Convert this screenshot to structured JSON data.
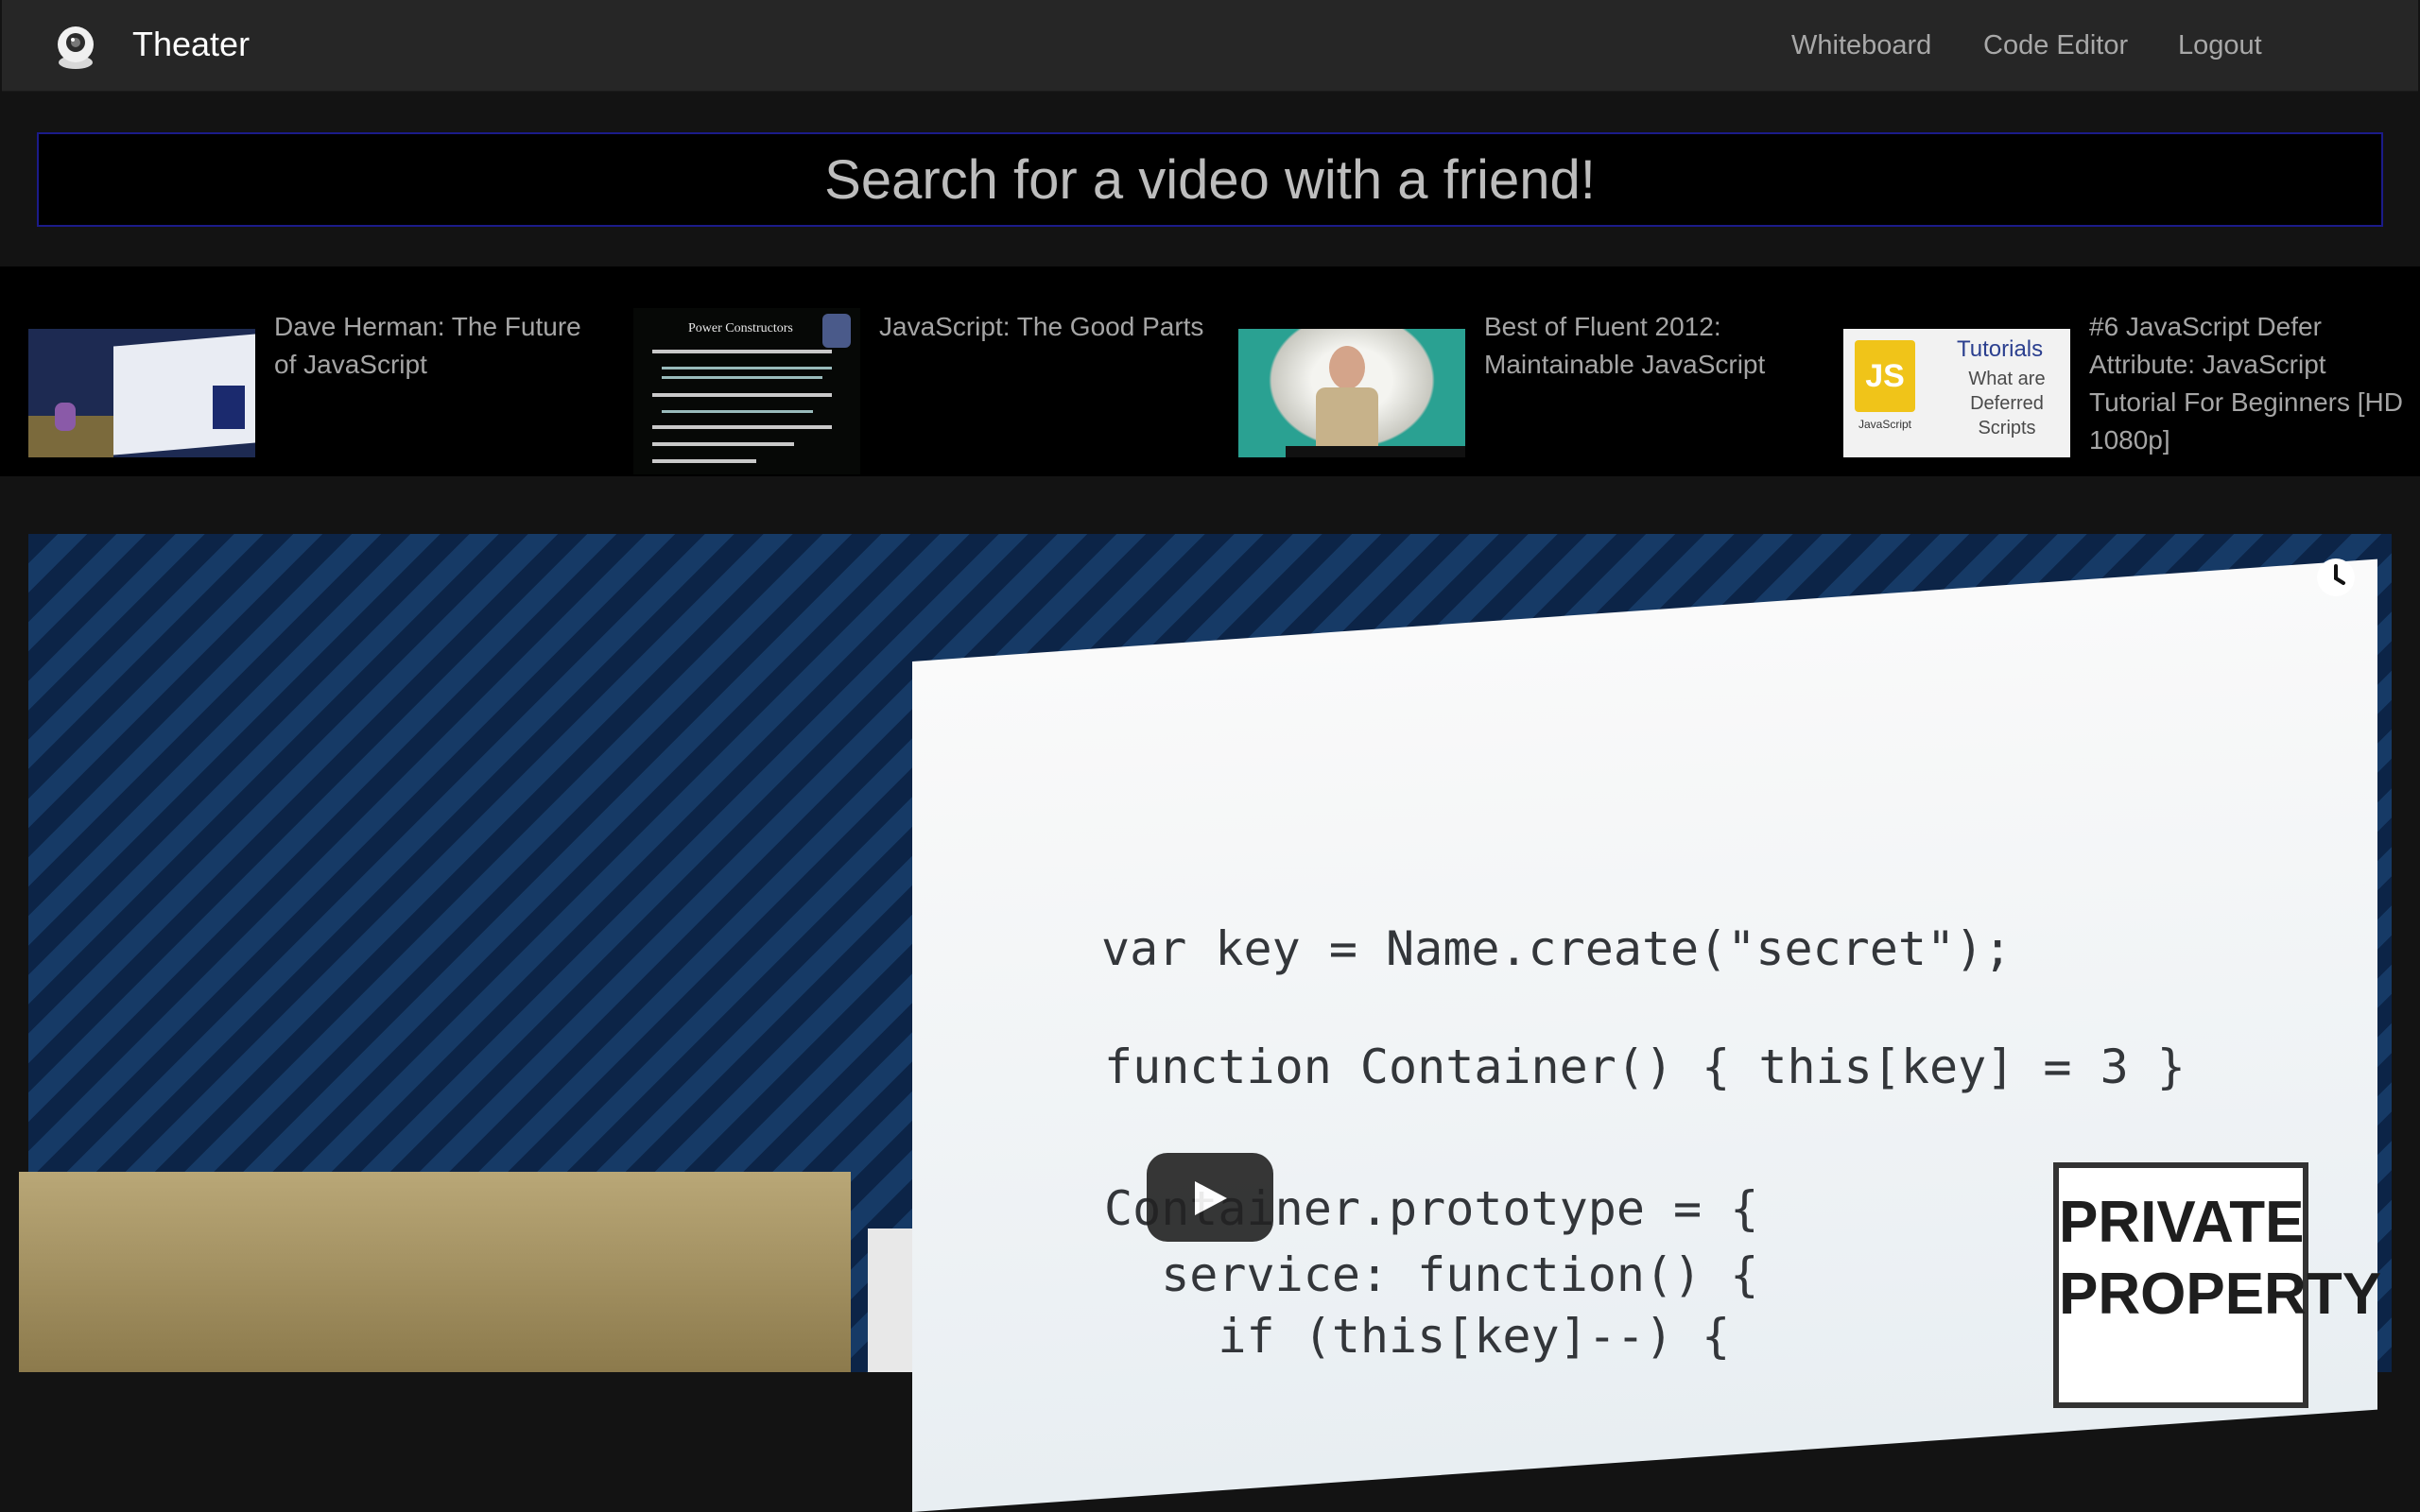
{
  "app": {
    "brand_name": "Theater",
    "logo_icon": "webcam-icon"
  },
  "nav": {
    "whiteboard": "Whiteboard",
    "code_editor": "Code Editor",
    "logout": "Logout"
  },
  "search": {
    "placeholder": "Search for a video with a friend!"
  },
  "results": [
    {
      "title": "Dave Herman: The Future of JavaScript"
    },
    {
      "title": "JavaScript: The Good Parts"
    },
    {
      "title": "Best of Fluent 2012: Maintainable JavaScript"
    },
    {
      "title": "#6 JavaScript Defer Attribute: JavaScript Tutorial For Beginners [HD 1080p]"
    }
  ],
  "thumbs": {
    "t2_heading": "Power Constructors",
    "t4_logo": "JS",
    "t4_logo_sub": "JavaScript",
    "t4_title": "Tutorials",
    "t4_lines": [
      "What are",
      "Deferred",
      "Scripts"
    ]
  },
  "player": {
    "code_lines": [
      "var key = Name.create(\"secret\");",
      "function Container() { this[key] = 3 }",
      "Container.prototype = {",
      "  service: function() {",
      "    if (this[key]--) {"
    ],
    "sign_lines": [
      "PRIVATE",
      "PROPERTY"
    ],
    "controls": {
      "watch_later_icon": "clock-icon",
      "play_icon": "play-icon"
    }
  },
  "colors": {
    "navbar_bg": "#262626",
    "page_bg": "#131313",
    "search_border": "#1b1b8a"
  }
}
